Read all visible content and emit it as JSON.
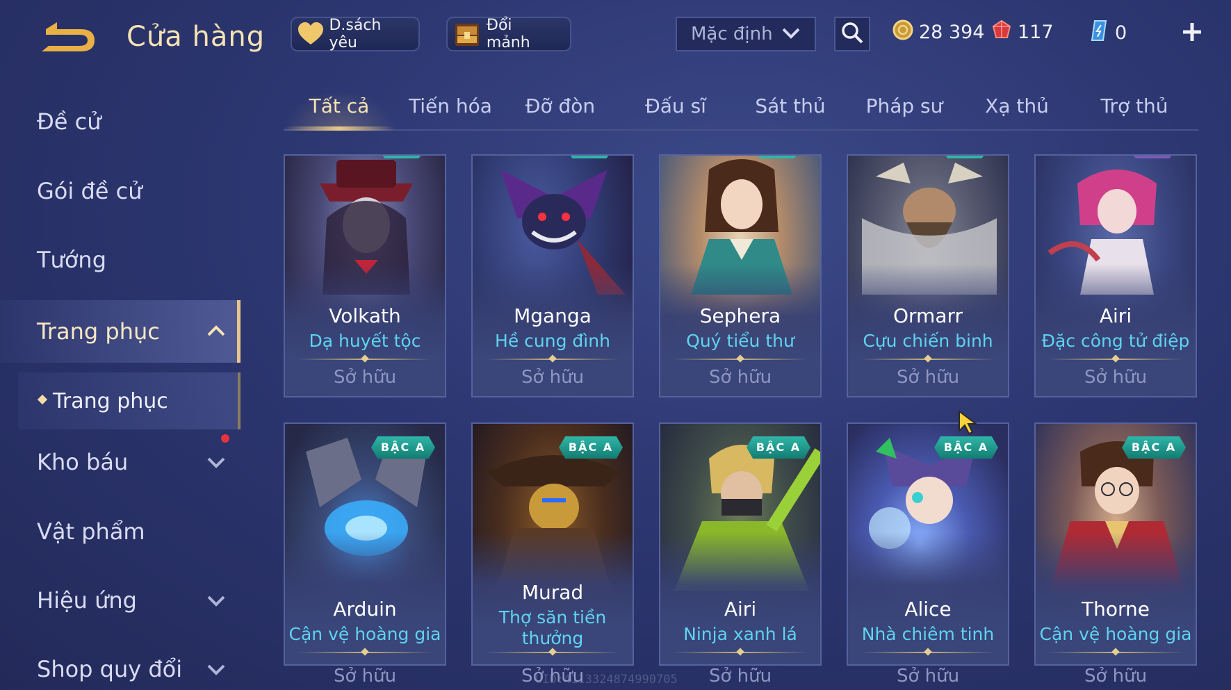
{
  "header": {
    "title": "Cửa hàng",
    "wishlist_label": "D.sách yêu",
    "exchange_label": "Đổi mảnh",
    "sort_value": "Mặc định",
    "currencies": {
      "gold": "28 394",
      "ruby": "117",
      "crystal": "0"
    }
  },
  "sidebar": {
    "items": [
      {
        "label": "Đề cử"
      },
      {
        "label": "Gói đề cử"
      },
      {
        "label": "Tướng"
      },
      {
        "label": "Trang phục"
      },
      {
        "label": "Kho báu"
      },
      {
        "label": "Vật phẩm"
      },
      {
        "label": "Hiệu ứng"
      },
      {
        "label": "Shop quy đổi"
      }
    ],
    "sub_item": "Trang phục"
  },
  "tabs": [
    "Tất cả",
    "Tiến hóa",
    "Đỡ đòn",
    "Đấu sĩ",
    "Sát thủ",
    "Pháp sư",
    "Xạ thủ",
    "Trợ thủ"
  ],
  "active_tab": "Tất cả",
  "cards": [
    {
      "hero": "Volkath",
      "skin": "Dạ huyết tộc",
      "status": "Sở hữu",
      "tier": ""
    },
    {
      "hero": "Mganga",
      "skin": "Hề cung đình",
      "status": "Sở hữu",
      "tier": ""
    },
    {
      "hero": "Sephera",
      "skin": "Quý tiểu thư",
      "status": "Sở hữu",
      "tier": ""
    },
    {
      "hero": "Ormarr",
      "skin": "Cựu chiến binh",
      "status": "Sở hữu",
      "tier": ""
    },
    {
      "hero": "Airi",
      "skin": "Đặc công tử điệp",
      "status": "Sở hữu",
      "tier": ""
    },
    {
      "hero": "Arduin",
      "skin": "Cận vệ hoàng gia",
      "status": "Sở hữu",
      "tier": "BẬC A"
    },
    {
      "hero": "Murad",
      "skin": "Thợ săn tiền thưởng",
      "status": "Sở hữu",
      "tier": "BẬC A"
    },
    {
      "hero": "Airi",
      "skin": "Ninja xanh lá",
      "status": "Sở hữu",
      "tier": "BẬC A"
    },
    {
      "hero": "Alice",
      "skin": "Nhà chiêm tinh",
      "status": "Sở hữu",
      "tier": "BẬC A"
    },
    {
      "hero": "Thorne",
      "skin": "Cận vệ hoàng gia",
      "status": "Sở hữu",
      "tier": "BẬC A"
    }
  ],
  "uid_watermark": "UID:4113324874990705",
  "colors": {
    "accent_gold": "#e7c88a",
    "skin_name": "#5fd3f0",
    "tier_badge": "#2fb6a8",
    "notification": "#e8323c"
  }
}
